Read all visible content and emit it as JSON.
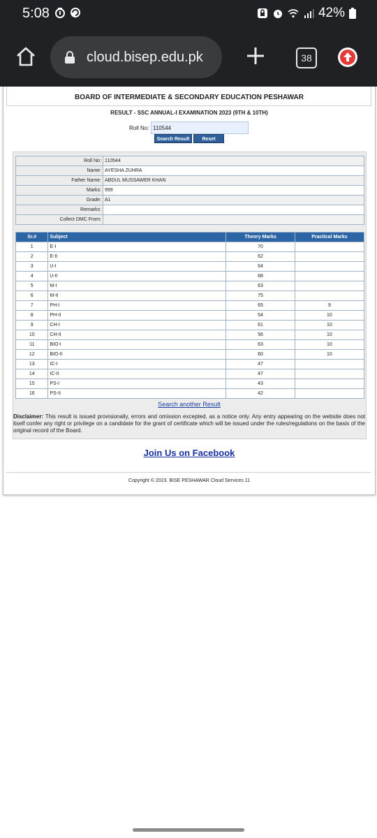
{
  "status_bar": {
    "time": "5:08",
    "battery": "42%"
  },
  "browser": {
    "url": "cloud.bisep.edu.pk",
    "tab_count": "38"
  },
  "page": {
    "board_title": "BOARD OF INTERMEDIATE & SECONDARY EDUCATION PESHAWAR",
    "result_title": "RESULT - SSC ANNUAL-I EXAMINATION 2023 (9TH & 10TH)",
    "roll_label": "Roll No:",
    "roll_value": "110544",
    "search_label": "Search Result",
    "reset_label": "Reset"
  },
  "info": {
    "rows": [
      {
        "label": "Roll No:",
        "value": "110544"
      },
      {
        "label": "Name:",
        "value": "AYESHA ZUHRA"
      },
      {
        "label": "Father Name:",
        "value": "ABDUL MUSSAWER KHAN"
      },
      {
        "label": "Marks:",
        "value": "999"
      },
      {
        "label": "Grade:",
        "value": "A1"
      },
      {
        "label": "Remarks:",
        "value": ""
      },
      {
        "label": "Collect DMC From:",
        "value": ""
      }
    ]
  },
  "marks": {
    "headers": {
      "sr": "Sr.#",
      "subject": "Subject",
      "theory": "Theory Marks",
      "practical": "Practical Marks"
    },
    "rows": [
      {
        "sr": "1",
        "subject": "E-I",
        "theory": "70",
        "practical": ""
      },
      {
        "sr": "2",
        "subject": "E-II",
        "theory": "62",
        "practical": ""
      },
      {
        "sr": "3",
        "subject": "U-I",
        "theory": "64",
        "practical": ""
      },
      {
        "sr": "4",
        "subject": "U-II",
        "theory": "68",
        "practical": ""
      },
      {
        "sr": "5",
        "subject": "M-I",
        "theory": "63",
        "practical": ""
      },
      {
        "sr": "6",
        "subject": "M-II",
        "theory": "75",
        "practical": ""
      },
      {
        "sr": "7",
        "subject": "PH-I",
        "theory": "65",
        "practical": "9"
      },
      {
        "sr": "8",
        "subject": "PH-II",
        "theory": "54",
        "practical": "10"
      },
      {
        "sr": "9",
        "subject": "CH-I",
        "theory": "61",
        "practical": "10"
      },
      {
        "sr": "10",
        "subject": "CH-II",
        "theory": "56",
        "practical": "10"
      },
      {
        "sr": "11",
        "subject": "BIO-I",
        "theory": "63",
        "practical": "10"
      },
      {
        "sr": "12",
        "subject": "BIO-II",
        "theory": "60",
        "practical": "10"
      },
      {
        "sr": "13",
        "subject": "IC-I",
        "theory": "47",
        "practical": ""
      },
      {
        "sr": "14",
        "subject": "IC-II",
        "theory": "47",
        "practical": ""
      },
      {
        "sr": "15",
        "subject": "PS-I",
        "theory": "43",
        "practical": ""
      },
      {
        "sr": "16",
        "subject": "PS-II",
        "theory": "42",
        "practical": ""
      }
    ]
  },
  "footer": {
    "search_another": "Search another Result",
    "disclaimer_label": "Disclaimer:",
    "disclaimer_text": " This result is issued provisionally, errors and omission excepted, as a notice only. Any entry appearing on the website does not itself confer any right or privilege on a candidate for the grant of certificate which will be issued under the rules/regulations on the basis of the original record of the Board.",
    "facebook": "Join Us on Facebook",
    "copyright": "Copyright © 2023. BISE PESHAWAR Cloud Services 11"
  }
}
